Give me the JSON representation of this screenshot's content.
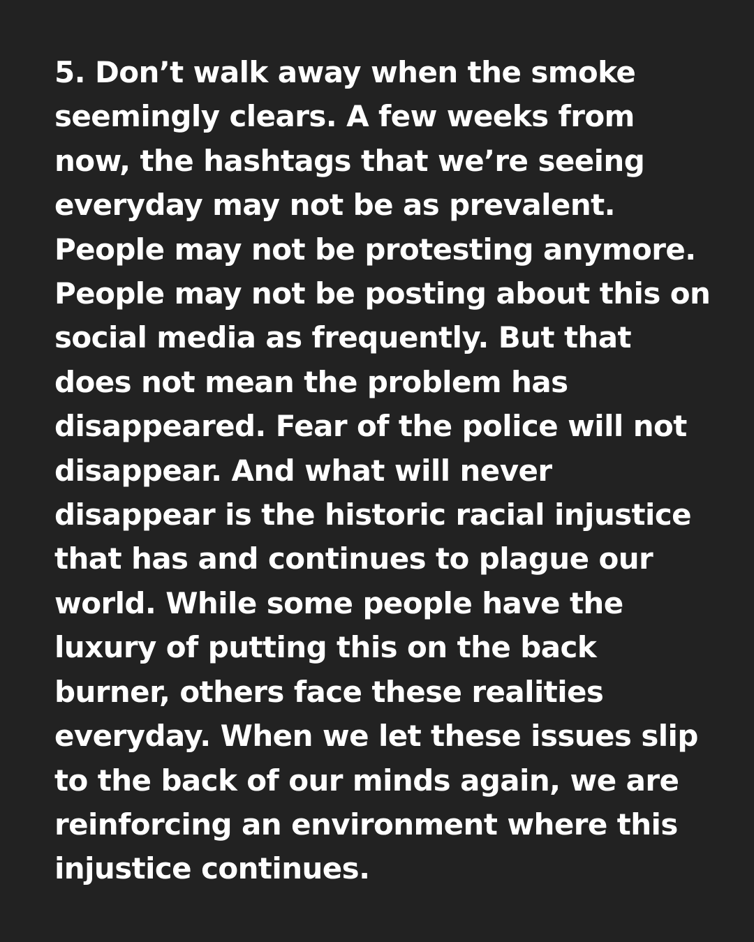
{
  "post": {
    "background_color": "#222222",
    "text_color": "#ffffff",
    "lines": [
      "5. Don’t walk away when the smoke",
      "seemingly clears. A few weeks from",
      "now, the hashtags that we’re seeing",
      "everyday may not be as prevalent.",
      "People may not be protesting anymore.",
      "People may not be posting about this on",
      "social media as frequently. But that",
      "does not mean the problem has",
      "disappeared. Fear of the police will not",
      "disappear. And what will never",
      "disappear is the historic racial injustice",
      "that has and continues to plague our",
      "world. While some people have the",
      "luxury of putting this on the back",
      "burner, others face these realities",
      "everyday. When we let these issues slip",
      "to the back of our minds again, we are",
      "reinforcing an environment where this",
      "injustice continues."
    ]
  }
}
